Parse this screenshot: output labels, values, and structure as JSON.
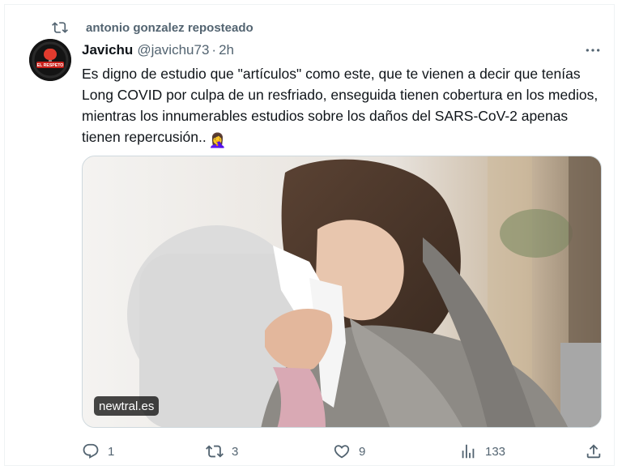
{
  "repost_banner": {
    "text": "antonio gonzalez reposteado",
    "icon": "repost-icon"
  },
  "author": {
    "name": "Javichu",
    "handle": "@javichu73",
    "separator": "·",
    "time": "2h",
    "avatar_text": "EL RESPETO"
  },
  "more_icon": "more-icon",
  "tweet": {
    "text": "Es digno de estudio que \"artículos\" como este, que te vienen a decir que tenías Long COVID por culpa de un resfriado, enseguida tienen cobertura en los medios, mientras los innumerables estudios sobre los daños del SARS-CoV-2 apenas tienen repercusión..",
    "emoji": "🤦‍♀️"
  },
  "media": {
    "source": "newtral.es"
  },
  "actions": {
    "reply": {
      "icon": "reply-icon",
      "count": "1"
    },
    "repost": {
      "icon": "repost-icon",
      "count": "3"
    },
    "like": {
      "icon": "heart-icon",
      "count": "9"
    },
    "views": {
      "icon": "views-icon",
      "count": "133"
    },
    "share": {
      "icon": "share-icon"
    }
  },
  "colors": {
    "text": "#0f1419",
    "secondary": "#536471",
    "border": "#cfd9de"
  }
}
